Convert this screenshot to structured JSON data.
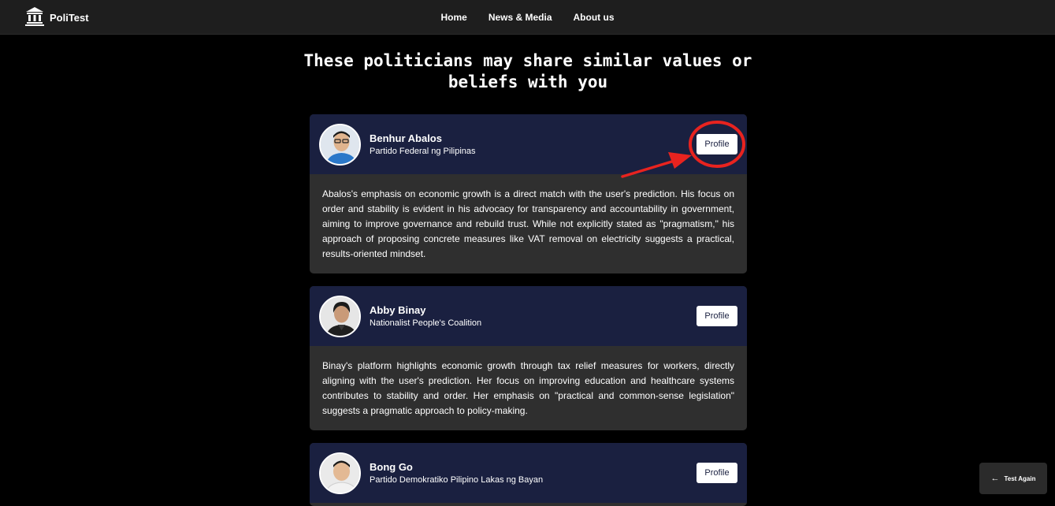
{
  "brand": {
    "name": "PoliTest",
    "icon": "building-columns-icon"
  },
  "nav": {
    "links": [
      "Home",
      "News & Media",
      "About us"
    ]
  },
  "heading": "These politicians may share similar values or beliefs with you",
  "politicians": [
    {
      "name": "Benhur Abalos",
      "party": "Partido Federal ng Pilipinas",
      "button": "Profile",
      "description": "Abalos's emphasis on economic growth is a direct match with the user's prediction. His focus on order and stability is evident in his advocacy for transparency and accountability in government, aiming to improve governance and rebuild trust. While not explicitly stated as \"pragmatism,\" his approach of proposing concrete measures like VAT removal on electricity suggests a practical, results-oriented mindset."
    },
    {
      "name": "Abby Binay",
      "party": "Nationalist People's Coalition",
      "button": "Profile",
      "description": "Binay's platform highlights economic growth through tax relief measures for workers, directly aligning with the user's prediction. Her focus on improving education and healthcare systems contributes to stability and order. Her emphasis on \"practical and common-sense legislation\" suggests a pragmatic approach to policy-making."
    },
    {
      "name": "Bong Go",
      "party": "Partido Demokratiko Pilipino Lakas ng Bayan",
      "button": "Profile",
      "description": ""
    }
  ],
  "test_again": {
    "label": "Test Again",
    "icon": "arrow-left-icon"
  },
  "colors": {
    "background": "#000000",
    "navbar": "#1e1e1e",
    "card_header": "#1a2040",
    "card_body": "#2f2f2f",
    "annotation_red": "#e8231f"
  }
}
